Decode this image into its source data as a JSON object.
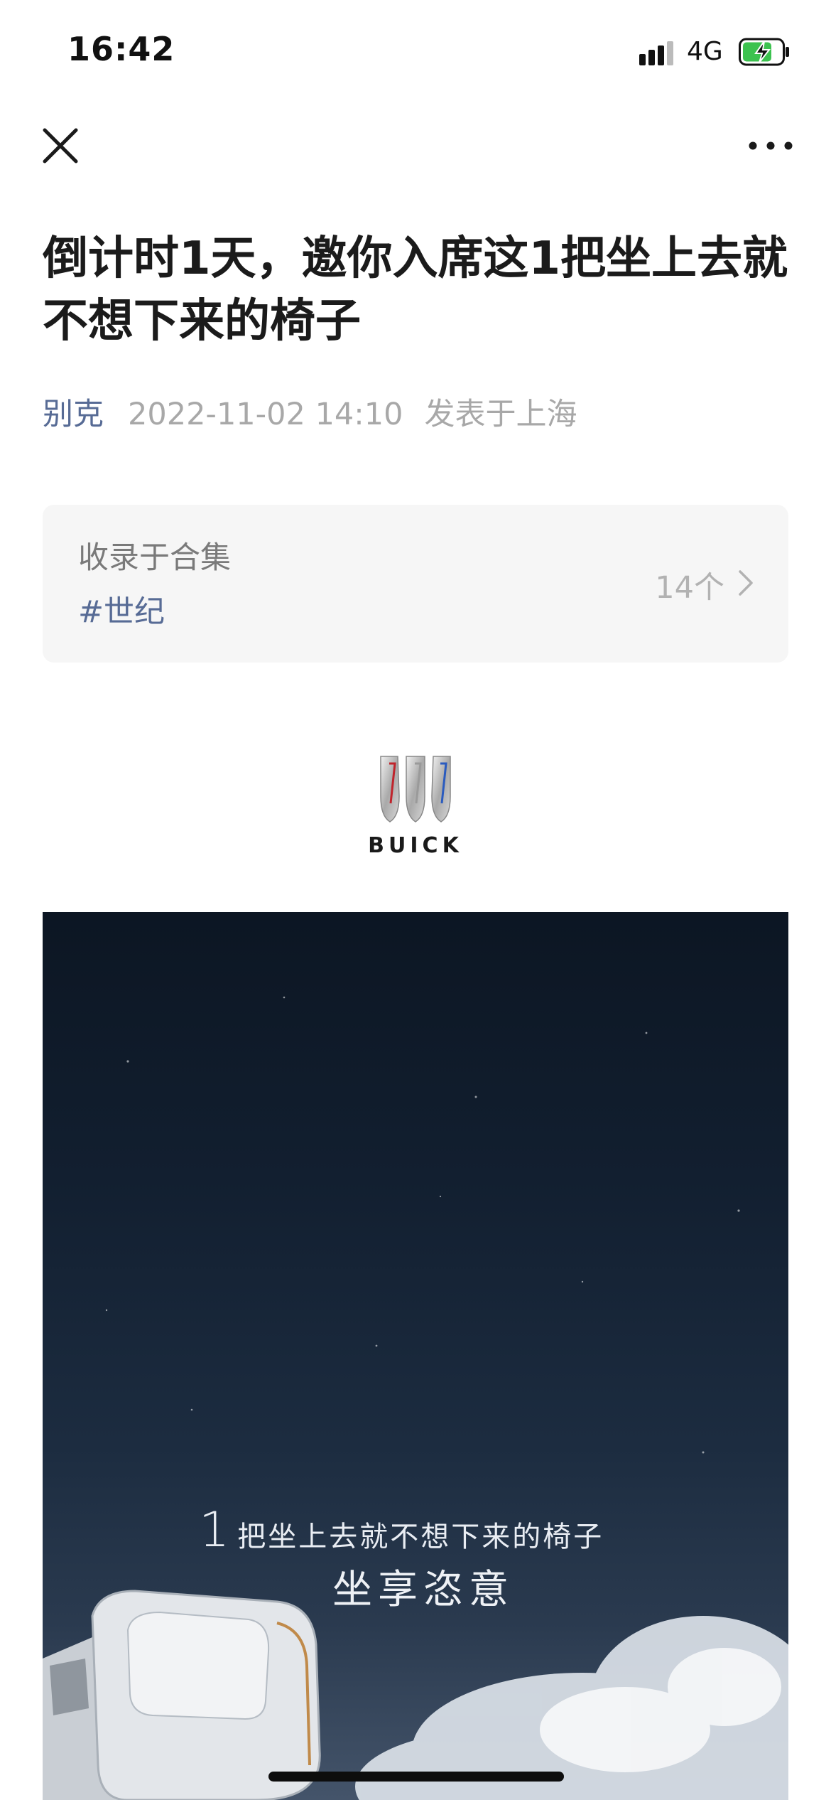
{
  "status_bar": {
    "time": "16:42",
    "network": "4G",
    "battery_state": "charging"
  },
  "nav": {
    "close_icon": "close-icon",
    "more_icon": "more-icon"
  },
  "article": {
    "title": "倒计时1天，邀你入席这1把坐上去就不想下来的椅子",
    "author": "别克",
    "date": "2022-11-02 14:10",
    "location": "发表于上海"
  },
  "collection": {
    "label": "收录于合集",
    "tag": "#世纪",
    "count": "14个"
  },
  "logo": {
    "text": "BUICK"
  },
  "poster": {
    "headline_number": "1",
    "headline_rest": "把坐上去就不想下来的椅子",
    "subline": "坐享恣意"
  },
  "colors": {
    "link_blue": "#576b95",
    "meta_gray": "#a8a8a8",
    "card_bg": "#f6f6f6",
    "poster_dark": "#0c1623"
  }
}
